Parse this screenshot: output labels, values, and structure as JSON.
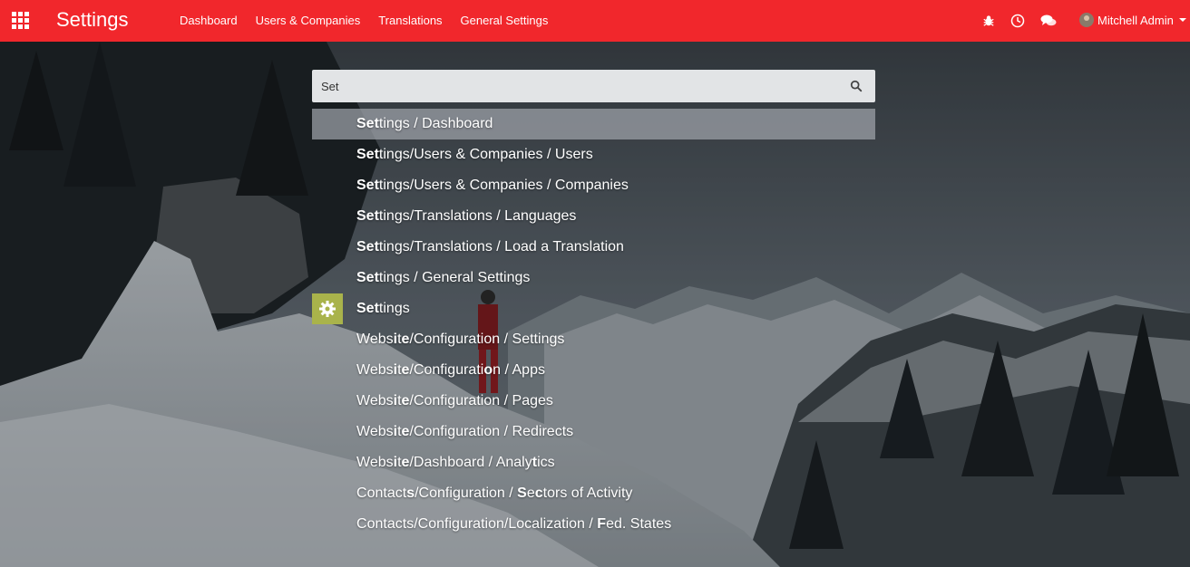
{
  "navbar": {
    "app_title": "Settings",
    "menu": [
      "Dashboard",
      "Users & Companies",
      "Translations",
      "General Settings"
    ],
    "user_name": "Mitchell Admin",
    "icons": [
      "apps-grid-icon",
      "bug-icon",
      "clock-icon",
      "chat-icon",
      "avatar",
      "caret-down-icon"
    ],
    "color": "#f1272c"
  },
  "search": {
    "value": "Set",
    "icon": "search-icon"
  },
  "results": [
    {
      "text": "Settings / Dashboard",
      "bold_chars": [
        0,
        1,
        2
      ],
      "active": true
    },
    {
      "text": "Settings/Users & Companies / Users",
      "bold_chars": [
        0,
        1,
        2
      ]
    },
    {
      "text": "Settings/Users & Companies / Companies",
      "bold_chars": [
        0,
        1,
        2
      ]
    },
    {
      "text": "Settings/Translations / Languages",
      "bold_chars": [
        0,
        1,
        2
      ]
    },
    {
      "text": "Settings/Translations / Load a Translation",
      "bold_chars": [
        0,
        1,
        2
      ]
    },
    {
      "text": "Settings / General Settings",
      "bold_chars": [
        0,
        1,
        2
      ]
    },
    {
      "text": "Settings",
      "bold_chars": [
        0,
        1,
        2
      ],
      "app_tile": true,
      "tile_icon": "gear-icon",
      "tile_color": "#a9b34b"
    },
    {
      "text": "Website/Configuration / Settings",
      "bold_chars": [
        4,
        6
      ]
    },
    {
      "text": "Website/Configuration / Apps",
      "bold_chars": [
        4,
        6,
        19
      ]
    },
    {
      "text": "Website/Configuration / Pages",
      "bold_chars": [
        4,
        6
      ]
    },
    {
      "text": "Website/Configuration / Redirects",
      "bold_chars": [
        4,
        6
      ]
    },
    {
      "text": "Website/Dashboard / Analytics",
      "bold_chars": [
        4,
        6,
        25
      ]
    },
    {
      "text": "Contacts/Configuration / Sectors of Activity",
      "bold_chars": [
        7,
        25,
        27
      ]
    },
    {
      "text": "Contacts/Configuration/Localization / Fed. States",
      "bold_chars": [
        38,
        42
      ]
    }
  ]
}
